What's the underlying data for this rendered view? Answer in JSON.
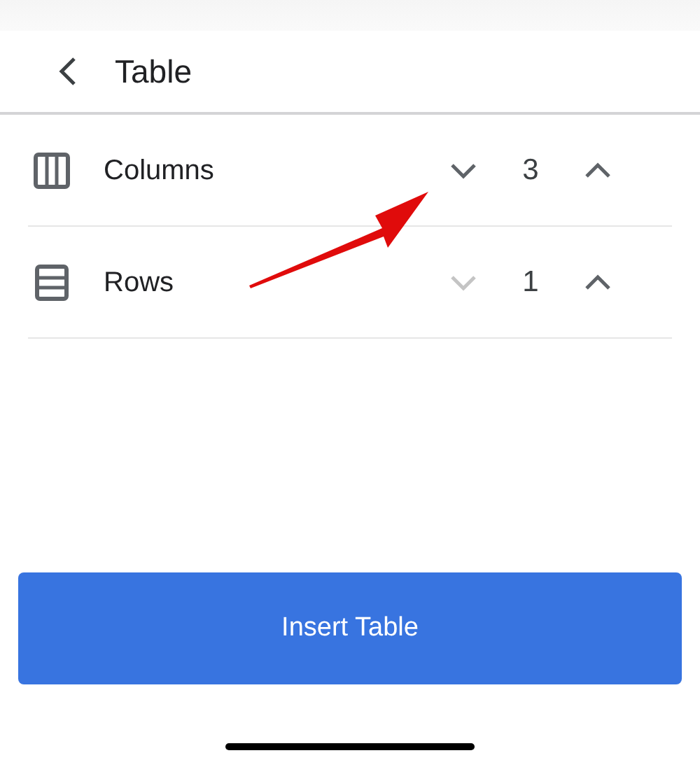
{
  "header": {
    "title": "Table"
  },
  "settings": [
    {
      "kind": "columns",
      "label": "Columns",
      "value": "3",
      "decrement_disabled": false,
      "increment_disabled": false
    },
    {
      "kind": "rows",
      "label": "Rows",
      "value": "1",
      "decrement_disabled": true,
      "increment_disabled": false
    }
  ],
  "primary_button": {
    "label": "Insert Table"
  }
}
